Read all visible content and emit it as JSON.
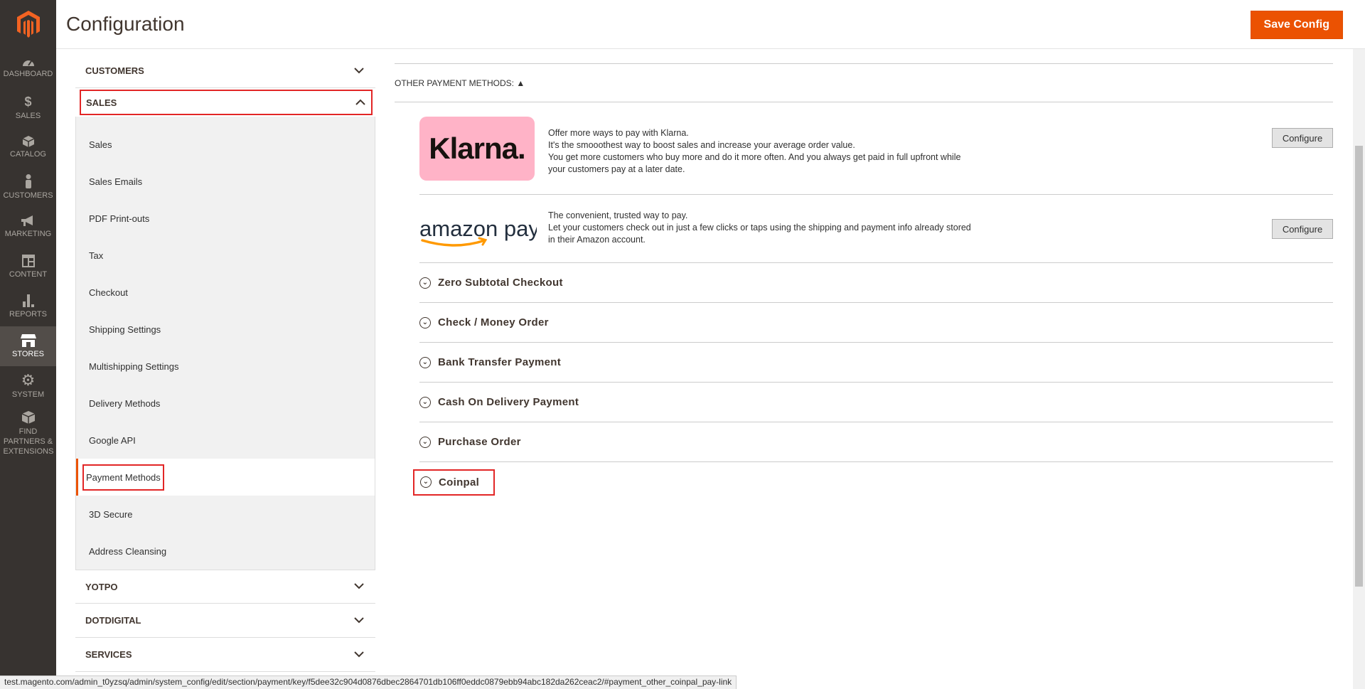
{
  "nav": {
    "items": [
      {
        "label": "DASHBOARD",
        "icon": "dashboard-icon"
      },
      {
        "label": "SALES",
        "icon": "dollar-icon"
      },
      {
        "label": "CATALOG",
        "icon": "box-icon"
      },
      {
        "label": "CUSTOMERS",
        "icon": "person-icon"
      },
      {
        "label": "MARKETING",
        "icon": "megaphone-icon"
      },
      {
        "label": "CONTENT",
        "icon": "layout-icon"
      },
      {
        "label": "REPORTS",
        "icon": "bar-chart-icon"
      },
      {
        "label": "STORES",
        "icon": "storefront-icon"
      },
      {
        "label": "SYSTEM",
        "icon": "gear-icon"
      },
      {
        "label": "FIND PARTNERS & EXTENSIONS",
        "icon": "cube-icon"
      }
    ]
  },
  "header": {
    "title": "Configuration",
    "save_label": "Save Config"
  },
  "sidebar": {
    "customers": "CUSTOMERS",
    "sales": "SALES",
    "sales_items": [
      "Sales",
      "Sales Emails",
      "PDF Print-outs",
      "Tax",
      "Checkout",
      "Shipping Settings",
      "Multishipping Settings",
      "Delivery Methods",
      "Google API",
      "Payment Methods",
      "3D Secure",
      "Address Cleansing"
    ],
    "yotpo": "YOTPO",
    "dotdigital": "DOTDIGITAL",
    "services": "SERVICES"
  },
  "main": {
    "other_methods_heading": "OTHER PAYMENT METHODS: ▲",
    "klarna": {
      "logo_text": "Klarna.",
      "lines": [
        "Offer more ways to pay with Klarna.",
        "It's the smooothest way to boost sales and increase your average order value.",
        "You get more customers who buy more and do it more often. And you always get paid in full upfront while",
        "your customers pay at a later date."
      ],
      "button": "Configure"
    },
    "amazon": {
      "logo_text": "amazon pay",
      "lines": [
        "The convenient, trusted way to pay.",
        "Let your customers check out in just a few clicks or taps using the shipping and payment info already stored",
        "in their Amazon account."
      ],
      "button": "Configure"
    },
    "methods": [
      "Zero Subtotal Checkout",
      "Check / Money Order",
      "Bank Transfer Payment",
      "Cash On Delivery Payment",
      "Purchase Order",
      "Coinpal"
    ]
  },
  "status_url": "test.magento.com/admin_t0yzsq/admin/system_config/edit/section/payment/key/f5dee32c904d0876dbec2864701db106ff0eddc0879ebb94abc182da262ceac2/#payment_other_coinpal_pay-link",
  "colors": {
    "accent": "#eb5202",
    "nav_bg": "#373330",
    "highlight": "#e22626",
    "klarna_pink": "#ffb3c7"
  }
}
